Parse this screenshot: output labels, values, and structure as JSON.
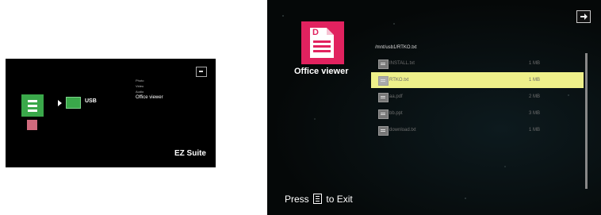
{
  "mini": {
    "exit_icon": "exit-icon",
    "usb_label": "USB",
    "menu": [
      "Photo",
      "Video",
      "Audio",
      "Office viewer"
    ],
    "selected_menu": "Office viewer",
    "brand": "EZ Suite",
    "colors": {
      "usb_green": "#3aa84a",
      "memory_pink": "#d06a7d"
    }
  },
  "main": {
    "exit_icon": "exit-icon",
    "app": {
      "title": "Office viewer",
      "icon": "office-document-icon",
      "icon_letter": "D",
      "icon_color": "#e1225f"
    },
    "path": "/mnt/usb1/RTKO.txt",
    "files": [
      {
        "name": "INSTALL.txt",
        "size": "1 MB"
      },
      {
        "name": "RTKO.txt",
        "size": "1 MB"
      },
      {
        "name": "aa.pdf",
        "size": "2 MB"
      },
      {
        "name": "bb.ppt",
        "size": "3 MB"
      },
      {
        "name": "download.txt",
        "size": "1 MB"
      }
    ],
    "selected_index": 1,
    "selection_color": "#eef08a",
    "footer": {
      "pre": "Press",
      "icon": "menu-icon",
      "post": "to Exit"
    }
  }
}
